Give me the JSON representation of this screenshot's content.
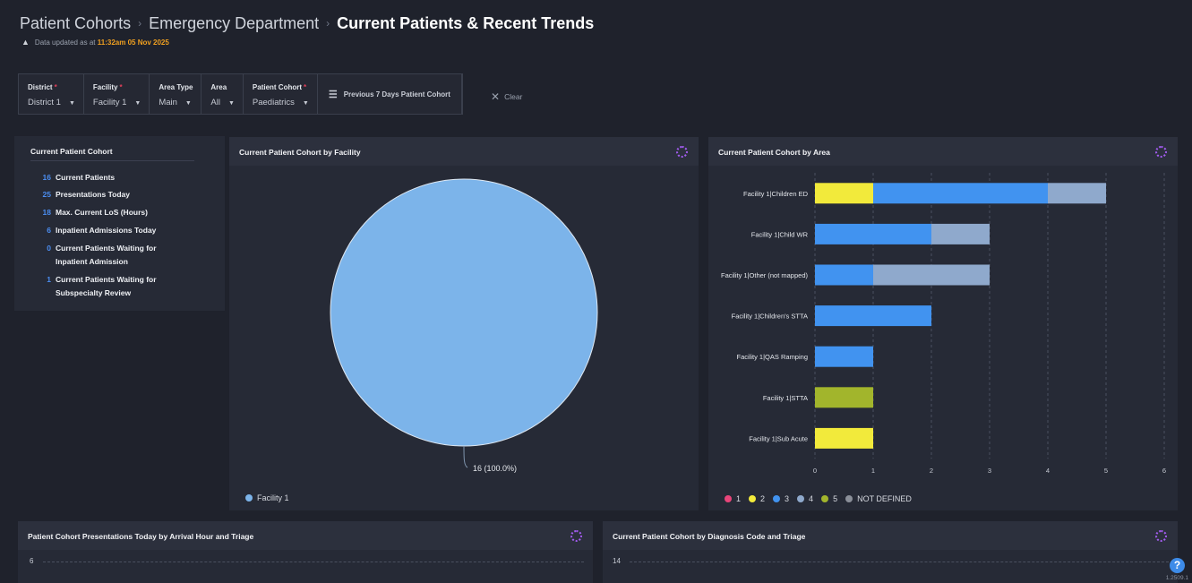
{
  "breadcrumb": {
    "items": [
      "Patient Cohorts",
      "Emergency Department"
    ],
    "current": "Current Patients & Recent Trends"
  },
  "update": {
    "prefix": "Data updated as at",
    "timestamp": "11:32am 05 Nov 2025"
  },
  "filters": [
    {
      "label": "District",
      "required": true,
      "value": "District 1"
    },
    {
      "label": "Facility",
      "required": true,
      "value": "Facility 1"
    },
    {
      "label": "Area Type",
      "required": false,
      "value": "Main"
    },
    {
      "label": "Area",
      "required": false,
      "value": "All"
    },
    {
      "label": "Patient Cohort",
      "required": true,
      "value": "Paediatrics"
    }
  ],
  "prev_button": "Previous 7 Days Patient Cohort",
  "clear_label": "Clear",
  "kpi_panel": {
    "title": "Current Patient Cohort",
    "items": [
      {
        "value": "16",
        "label": "Current Patients",
        "cont": ""
      },
      {
        "value": "25",
        "label": "Presentations Today",
        "cont": ""
      },
      {
        "value": "18",
        "label": "Max. Current LoS (Hours)",
        "cont": ""
      },
      {
        "value": "6",
        "label": "Inpatient Admissions Today",
        "cont": ""
      },
      {
        "value": "0",
        "label": "Current Patients Waiting for",
        "cont": "Inpatient Admission"
      },
      {
        "value": "1",
        "label": "Current Patients Waiting for",
        "cont": "Subspecialty Review"
      }
    ]
  },
  "pie_panel": {
    "title": "Current Patient Cohort by Facility"
  },
  "bar_panel": {
    "title": "Current Patient Cohort by Area"
  },
  "arrival_panel": {
    "title": "Patient Cohort Presentations Today by Arrival Hour and Triage",
    "top_tick": "6"
  },
  "diagnosis_panel": {
    "title": "Current Patient Cohort by Diagnosis Code and Triage",
    "top_tick": "14"
  },
  "version": "1.2509.1",
  "help_label": "?",
  "colors": {
    "triage_1": "#e8457a",
    "triage_2": "#f2ea3b",
    "triage_3": "#4193f0",
    "triage_4": "#8fa9cc",
    "triage_5": "#a2b52c",
    "not_defined": "#8a8f99",
    "pie": "#7cb4ea",
    "accent": "#f0a020"
  },
  "chart_data": [
    {
      "type": "pie",
      "title": "Current Patient Cohort by Facility",
      "slices": [
        {
          "label": "Facility 1",
          "value": 16,
          "data_label": "16 (100.0%)"
        }
      ]
    },
    {
      "type": "bar",
      "orientation": "horizontal",
      "stacked": true,
      "title": "Current Patient Cohort by Area",
      "categories": [
        "Facility 1|Children ED",
        "Facility 1|Child WR",
        "Facility 1|Other (not mapped)",
        "Facility 1|Children's STTA",
        "Facility 1|QAS Ramping",
        "Facility 1|STTA",
        "Facility 1|Sub Acute"
      ],
      "series": [
        {
          "name": "1",
          "color": "#e8457a",
          "values": [
            0,
            0,
            0,
            0,
            0,
            0,
            0
          ]
        },
        {
          "name": "2",
          "color": "#f2ea3b",
          "values": [
            1,
            0,
            0,
            0,
            0,
            0,
            1
          ]
        },
        {
          "name": "3",
          "color": "#4193f0",
          "values": [
            3,
            2,
            1,
            2,
            1,
            0,
            0
          ]
        },
        {
          "name": "4",
          "color": "#8fa9cc",
          "values": [
            1,
            1,
            2,
            0,
            0,
            0,
            0
          ]
        },
        {
          "name": "5",
          "color": "#a2b52c",
          "values": [
            0,
            0,
            0,
            0,
            0,
            1,
            0
          ]
        },
        {
          "name": "NOT DEFINED",
          "color": "#8a8f99",
          "values": [
            0,
            0,
            0,
            0,
            0,
            0,
            0
          ]
        }
      ],
      "xlim": [
        0,
        6
      ],
      "xticks": [
        0,
        1,
        2,
        3,
        4,
        5,
        6
      ],
      "grid": true,
      "legend": "bottom"
    }
  ]
}
